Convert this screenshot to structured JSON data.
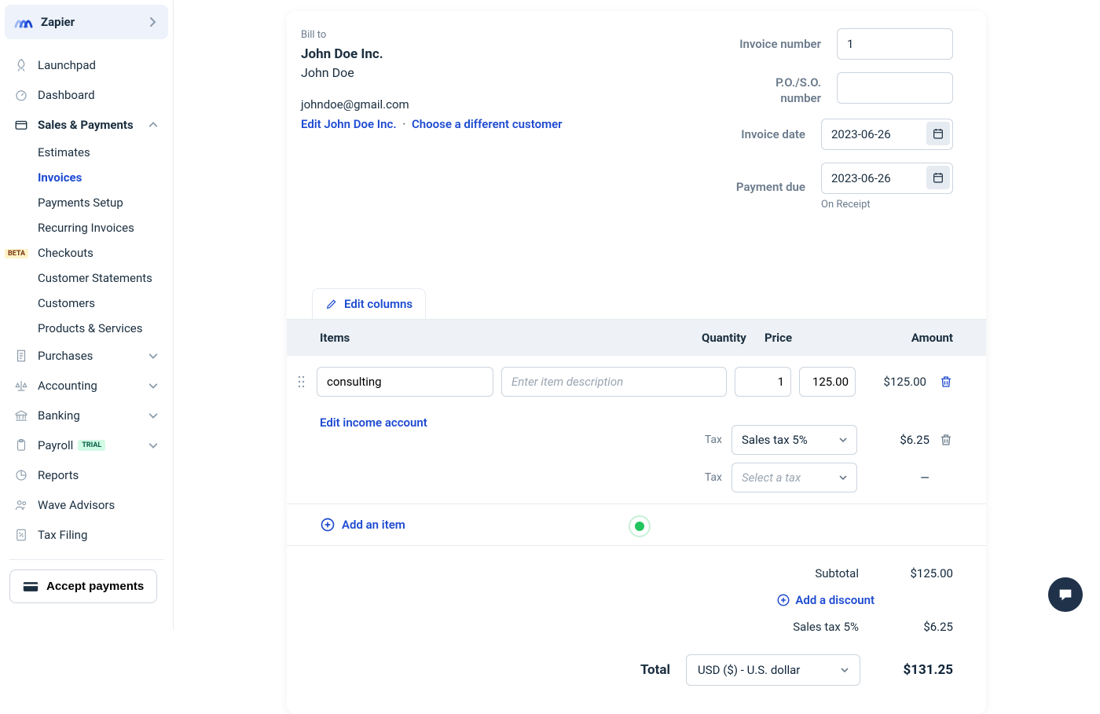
{
  "app": {
    "name": "Zapier"
  },
  "sidebar": {
    "launchpad": "Launchpad",
    "dashboard": "Dashboard",
    "sales": {
      "label": "Sales & Payments",
      "estimates": "Estimates",
      "invoices": "Invoices",
      "payments_setup": "Payments Setup",
      "recurring": "Recurring Invoices",
      "checkouts": "Checkouts",
      "checkouts_badge": "BETA",
      "customer_statements": "Customer Statements",
      "customers": "Customers",
      "products": "Products & Services"
    },
    "purchases": "Purchases",
    "accounting": "Accounting",
    "banking": "Banking",
    "payroll": {
      "label": "Payroll",
      "badge": "TRIAL"
    },
    "reports": "Reports",
    "advisors": "Wave Advisors",
    "tax_filing": "Tax Filing",
    "accept_payments": "Accept payments"
  },
  "invoice": {
    "bill_to_label": "Bill to",
    "company": "John Doe Inc.",
    "person": "John Doe",
    "email": "johndoe@gmail.com",
    "edit_link": "Edit John Doe Inc.",
    "choose_link": "Choose a different customer",
    "fields": {
      "number_label": "Invoice number",
      "number_value": "1",
      "po_label": "P.O./S.O. number",
      "po_value": "",
      "date_label": "Invoice date",
      "date_value": "2023-06-26",
      "due_label": "Payment due",
      "due_value": "2023-06-26",
      "due_note": "On Receipt"
    },
    "edit_columns": "Edit columns",
    "columns": {
      "items": "Items",
      "qty": "Quantity",
      "price": "Price",
      "amount": "Amount"
    },
    "line": {
      "name": "consulting",
      "desc_placeholder": "Enter item description",
      "qty": "1",
      "price": "125.00",
      "amount": "$125.00",
      "tax_label": "Tax",
      "tax1": {
        "label": "Sales tax 5%",
        "amount": "$6.25"
      },
      "tax2": {
        "placeholder": "Select a tax",
        "amount": "—"
      },
      "edit_income": "Edit income account"
    },
    "add_item": "Add an item",
    "totals": {
      "subtotal_label": "Subtotal",
      "subtotal_value": "$125.00",
      "discount_label": "Add a discount",
      "tax_label": "Sales tax 5%",
      "tax_value": "$6.25",
      "total_label": "Total",
      "currency": "USD ($) - U.S. dollar",
      "total_value": "$131.25"
    }
  }
}
